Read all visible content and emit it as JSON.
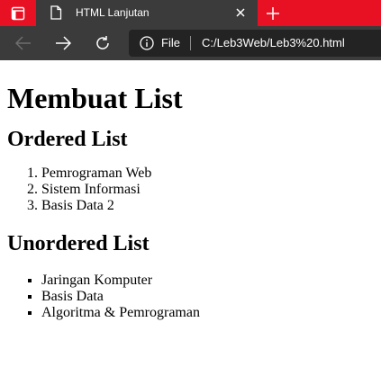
{
  "browser": {
    "tab": {
      "title": "HTML Lanjutan"
    },
    "address_bar": {
      "scheme_label": "File",
      "url": "C:/Leb3Web/Leb3%20.html"
    },
    "colors": {
      "tab_strip": "#e81123",
      "toolbar": "#3b3b3b",
      "address_field": "#232323"
    }
  },
  "page": {
    "heading": "Membuat List",
    "ordered_section": {
      "heading": "Ordered List",
      "items": [
        "Pemrograman Web",
        "Sistem Informasi",
        "Basis Data 2"
      ]
    },
    "unordered_section": {
      "heading": "Unordered List",
      "items": [
        "Jaringan Komputer",
        "Basis Data",
        "Algoritma & Pemrograman"
      ]
    }
  }
}
